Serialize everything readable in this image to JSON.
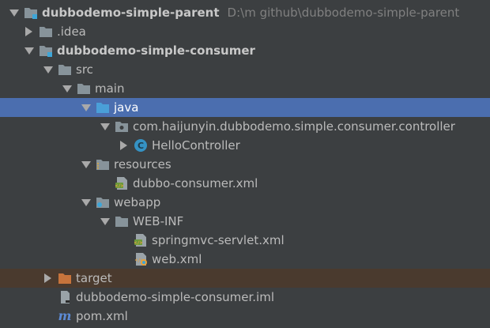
{
  "tree": {
    "root": {
      "label": "dubbodemo-simple-parent",
      "path": "D:\\m github\\dubbodemo-simple-parent",
      "icon": "module-folder-icon"
    },
    "idea": {
      "label": ".idea",
      "icon": "folder-icon"
    },
    "consumer": {
      "label": "dubbodemo-simple-consumer",
      "icon": "module-folder-icon"
    },
    "src": {
      "label": "src",
      "icon": "folder-icon"
    },
    "main": {
      "label": "main",
      "icon": "folder-icon"
    },
    "java": {
      "label": "java",
      "icon": "source-root-folder-icon"
    },
    "package": {
      "label": "com.haijunyin.dubbodemo.simple.consumer.controller",
      "icon": "package-icon"
    },
    "hello_controller": {
      "label": "HelloController",
      "icon": "java-class-icon"
    },
    "resources": {
      "label": "resources",
      "icon": "resources-folder-icon"
    },
    "dubbo_consumer_xml": {
      "label": "dubbo-consumer.xml",
      "icon": "spring-xml-icon"
    },
    "webapp": {
      "label": "webapp",
      "icon": "web-folder-icon"
    },
    "web_inf": {
      "label": "WEB-INF",
      "icon": "folder-icon"
    },
    "springmvc_xml": {
      "label": "springmvc-servlet.xml",
      "icon": "spring-xml-icon"
    },
    "web_xml": {
      "label": "web.xml",
      "icon": "web-xml-icon"
    },
    "target": {
      "label": "target",
      "icon": "excluded-folder-icon"
    },
    "iml": {
      "label": "dubbodemo-simple-consumer.iml",
      "icon": "iml-file-icon"
    },
    "pom": {
      "label": "pom.xml",
      "icon": "maven-icon"
    }
  },
  "colors": {
    "background": "#3c3f41",
    "selection": "#4b6eaf",
    "excluded_row": "#4a3a2e",
    "folder": "#87939a",
    "source_folder": "#4a9fd8",
    "excluded_folder": "#c7743c",
    "class_badge": "#3592c4",
    "maven": "#5c8bd6"
  }
}
